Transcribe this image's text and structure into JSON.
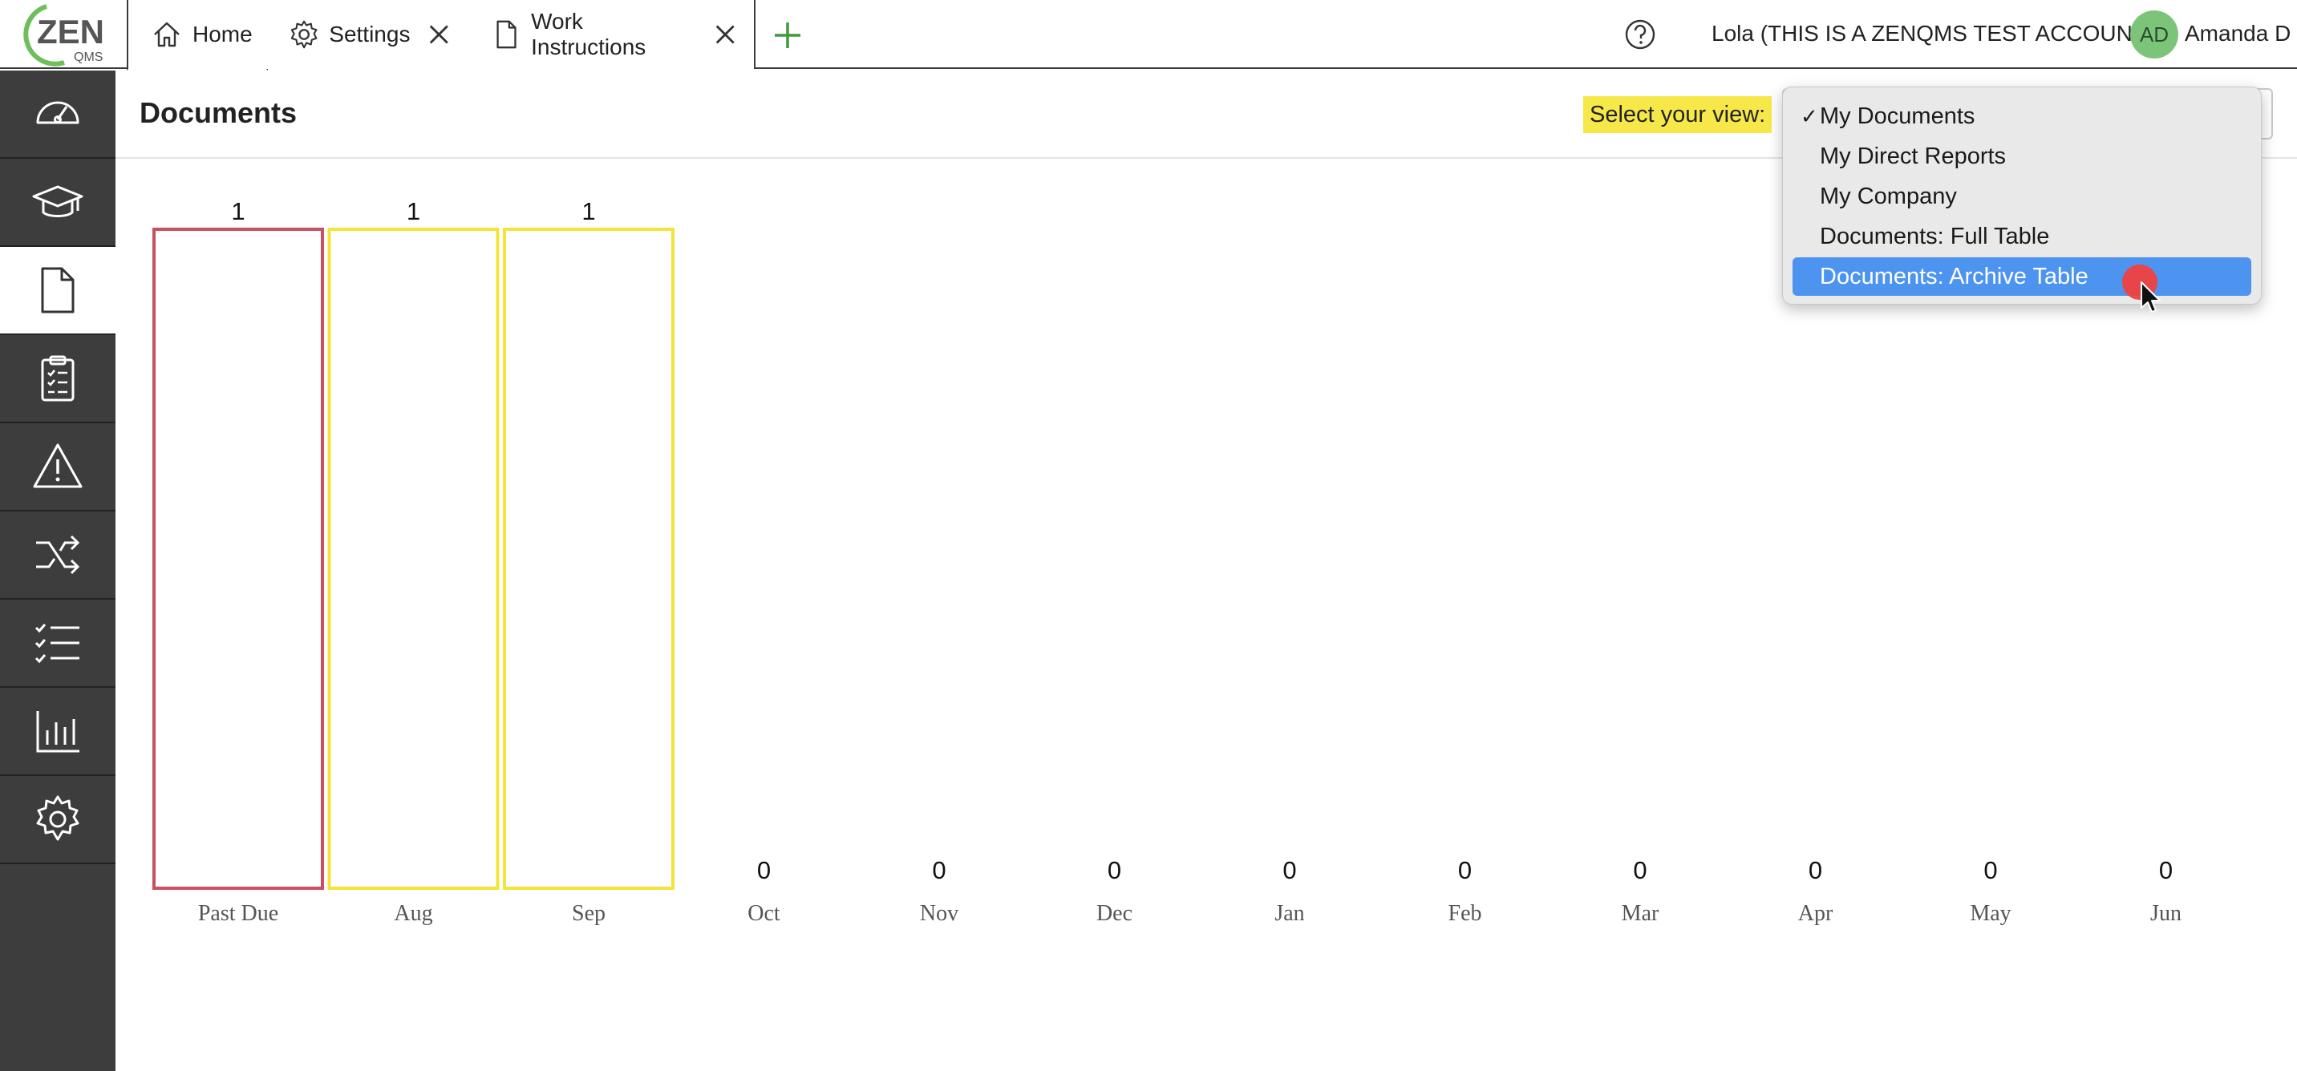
{
  "logo": {
    "main": "ZEN",
    "sub": "QMS"
  },
  "tabs": [
    {
      "label": "Home",
      "icon": "home-icon",
      "closable": false,
      "active": true
    },
    {
      "label": "Settings",
      "icon": "gear-icon",
      "closable": true,
      "active": false
    },
    {
      "label": "Work Instructions",
      "icon": "document-icon",
      "closable": true,
      "active": false
    }
  ],
  "header": {
    "account": "Lola (THIS IS A ZENQMS TEST ACCOUNT)",
    "avatar_initials": "AD",
    "user_name": "Amanda D"
  },
  "sidebar": {
    "items": [
      {
        "name": "dashboard-gauge-icon",
        "active": false
      },
      {
        "name": "training-graduation-cap-icon",
        "active": false
      },
      {
        "name": "documents-icon",
        "active": true
      },
      {
        "name": "clipboard-checklist-icon",
        "active": false
      },
      {
        "name": "warning-triangle-icon",
        "active": false
      },
      {
        "name": "shuffle-change-icon",
        "active": false
      },
      {
        "name": "checklist-icon",
        "active": false
      },
      {
        "name": "bar-chart-icon",
        "active": false
      },
      {
        "name": "settings-gear-icon",
        "active": false
      }
    ]
  },
  "page": {
    "title": "Documents",
    "view_label": "Select your view:"
  },
  "dropdown": {
    "options": [
      {
        "label": "My Documents",
        "checked": true,
        "highlighted": false
      },
      {
        "label": "My Direct Reports",
        "checked": false,
        "highlighted": false
      },
      {
        "label": "My Company",
        "checked": false,
        "highlighted": false
      },
      {
        "label": "Documents: Full Table",
        "checked": false,
        "highlighted": false
      },
      {
        "label": "Documents: Archive Table",
        "checked": false,
        "highlighted": true
      }
    ]
  },
  "colors": {
    "sidebar_bg": "#3d3d3d",
    "past_due": "#c9505e",
    "upcoming": "#f4e43a",
    "highlight": "#4c94f0",
    "view_label_bg": "#f7e84a"
  },
  "chart_data": {
    "type": "bar",
    "categories": [
      "Past Due",
      "Aug",
      "Sep",
      "Oct",
      "Nov",
      "Dec",
      "Jan",
      "Feb",
      "Mar",
      "Apr",
      "May",
      "Jun"
    ],
    "values": [
      1,
      1,
      1,
      0,
      0,
      0,
      0,
      0,
      0,
      0,
      0,
      0
    ],
    "bar_colors": [
      "#c9505e",
      "#f4e43a",
      "#f4e43a",
      "#f4e43a",
      "#f4e43a",
      "#f4e43a",
      "#f4e43a",
      "#f4e43a",
      "#f4e43a",
      "#f4e43a",
      "#f4e43a",
      "#f4e43a"
    ],
    "ylim": [
      0,
      1
    ],
    "title": "",
    "xlabel": "",
    "ylabel": "",
    "grid": false,
    "data_labels": true
  }
}
